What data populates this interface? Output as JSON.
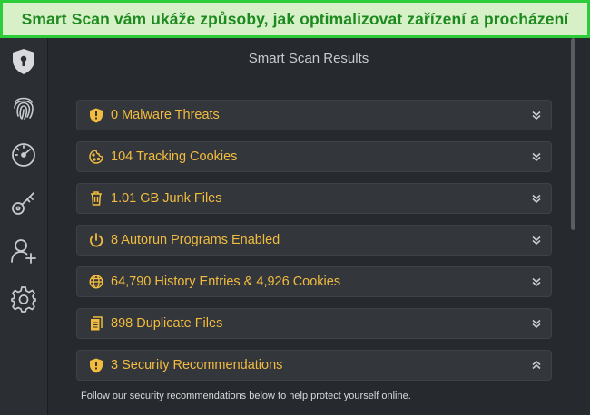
{
  "banner": {
    "text": "Smart Scan vám ukáže způsoby, jak optimalizovat zařízení a procházení"
  },
  "sidebar": {
    "items": [
      {
        "icon": "shield-icon"
      },
      {
        "icon": "fingerprint-icon"
      },
      {
        "icon": "speedometer-icon"
      },
      {
        "icon": "key-icon"
      },
      {
        "icon": "add-user-icon"
      },
      {
        "icon": "gear-icon"
      }
    ]
  },
  "main": {
    "title": "Smart Scan Results",
    "results": [
      {
        "icon": "shield-icon",
        "label": "0 Malware Threats",
        "expanded": false
      },
      {
        "icon": "cookie-icon",
        "label": "104 Tracking Cookies",
        "expanded": false
      },
      {
        "icon": "trash-icon",
        "label": "1.01 GB Junk Files",
        "expanded": false
      },
      {
        "icon": "power-icon",
        "label": "8 Autorun Programs Enabled",
        "expanded": false
      },
      {
        "icon": "globe-icon",
        "label": "64,790 History Entries & 4,926 Cookies",
        "expanded": false
      },
      {
        "icon": "files-icon",
        "label": "898 Duplicate Files",
        "expanded": false
      },
      {
        "icon": "shield-icon",
        "label": "3 Security Recommendations",
        "expanded": true
      }
    ],
    "recommendation_text": "Follow our security recommendations below to help protect yourself online."
  },
  "colors": {
    "accent": "#f2bc3f",
    "banner_bg": "#d8f0c7",
    "banner_border": "#2dcc3a",
    "banner_text": "#1d8a20",
    "background": "#26292d",
    "row_bg": "#33363b"
  }
}
